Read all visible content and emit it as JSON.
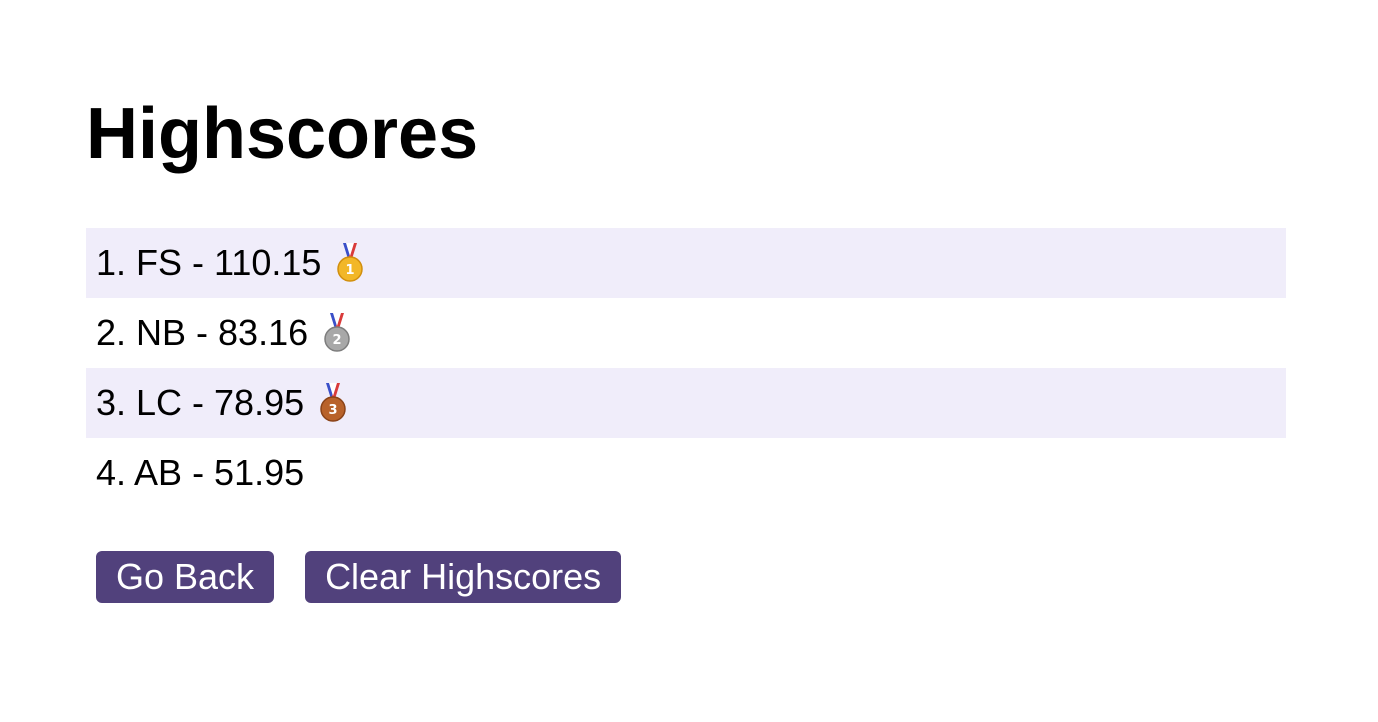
{
  "page": {
    "title": "Highscores"
  },
  "scores": [
    {
      "rank": "1.",
      "initials": "FS",
      "score": "110.15",
      "text": "1. FS - 110.15",
      "medal": "gold-medal-icon"
    },
    {
      "rank": "2.",
      "initials": "NB",
      "score": "83.16",
      "text": "2. NB - 83.16",
      "medal": "silver-medal-icon"
    },
    {
      "rank": "3.",
      "initials": "LC",
      "score": "78.95",
      "text": "3. LC - 78.95",
      "medal": "bronze-medal-icon"
    },
    {
      "rank": "4.",
      "initials": "AB",
      "score": "51.95",
      "text": "4. AB - 51.95",
      "medal": null
    }
  ],
  "buttons": {
    "go_back": "Go Back",
    "clear": "Clear Highscores"
  },
  "colors": {
    "button_bg": "#51417c",
    "row_shade": "#f0edfa",
    "gold": "#f2b728",
    "silver": "#a8a8a8",
    "bronze": "#b8622a"
  }
}
